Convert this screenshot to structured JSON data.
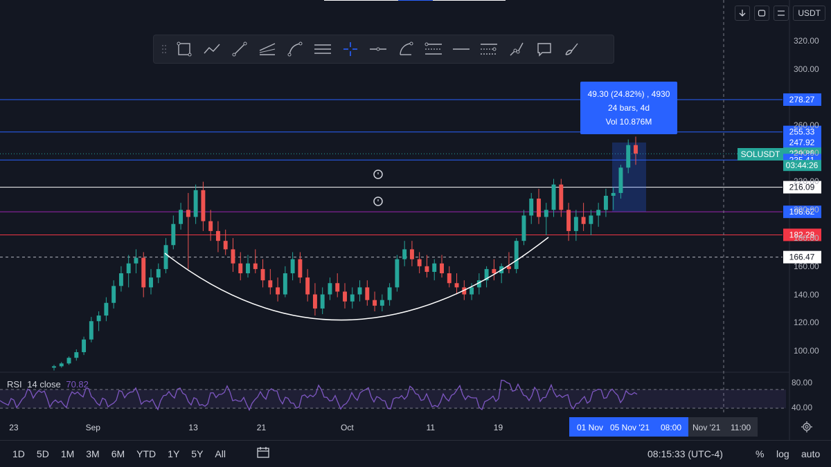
{
  "symbol": "SOLUSDT",
  "currency": "USDT",
  "toolbar": {
    "icons": [
      "grip-icon",
      "rectangle-icon",
      "path-icon",
      "trend-line-icon",
      "parallel-channel-icon",
      "curve-icon",
      "horizontal-lines-icon",
      "crosshair-icon",
      "horizontal-ray-icon",
      "arc-icon",
      "fib-retracement-icon",
      "horizontal-line-icon",
      "fib-extension-icon",
      "projection-icon",
      "callout-icon",
      "brush-icon"
    ]
  },
  "price_axis": {
    "ticks": [
      "320.00",
      "300.00",
      "260.00",
      "240.00",
      "220.00",
      "200.00",
      "180.00",
      "160.00",
      "140.00",
      "120.00",
      "100.00"
    ]
  },
  "price_labels": [
    {
      "value": 278.27,
      "text": "278.27",
      "bg": "#2962ff",
      "line": "#2962ff"
    },
    {
      "value": 255.33,
      "text": "255.33",
      "bg": "#2962ff",
      "line": "#2962ff"
    },
    {
      "value": 247.92,
      "text": "247.92",
      "bg": "#2962ff",
      "line": ""
    },
    {
      "value": 239.86,
      "text": "239.86",
      "bg": "#26a69a",
      "line": ""
    },
    {
      "value": 235.41,
      "text": "235.41",
      "bg": "#2962ff",
      "line": "#2962ff"
    },
    {
      "value": 216.09,
      "text": "216.09",
      "bg": "#ffffff",
      "line": "#ffffff"
    },
    {
      "value": 198.62,
      "text": "198.62",
      "bg": "#2962ff",
      "line": "#9c27b0"
    },
    {
      "value": 182.28,
      "text": "182.28",
      "bg": "#f23645",
      "line": "#f23645"
    },
    {
      "value": 166.47,
      "text": "166.47",
      "bg": "#ffffff",
      "line": "#b2b5be"
    }
  ],
  "countdown": "03:44:26",
  "measure_tooltip": {
    "line1": "49.30 (24.82%) , 4930",
    "line2": "24 bars, 4d",
    "line3": "Vol 10.876M"
  },
  "rsi": {
    "label": "RSI",
    "params": "14 close",
    "value": "70.82",
    "ticks": [
      "80.00",
      "40.00"
    ]
  },
  "time_axis": {
    "labels": [
      {
        "text": "23",
        "x": 0.016
      },
      {
        "text": "Sep",
        "x": 0.108
      },
      {
        "text": "13",
        "x": 0.232
      },
      {
        "text": "21",
        "x": 0.314
      },
      {
        "text": "Oct",
        "x": 0.415
      },
      {
        "text": "11",
        "x": 0.518
      },
      {
        "text": "19",
        "x": 0.599
      }
    ],
    "highlight": [
      "01 Nov",
      "05 Nov '21",
      "08:00"
    ],
    "extra": [
      "Nov '21",
      "11:00"
    ]
  },
  "bottom": {
    "ranges": [
      "1D",
      "5D",
      "1M",
      "3M",
      "6M",
      "YTD",
      "1Y",
      "5Y",
      "All"
    ],
    "clock": "08:15:33 (UTC-4)",
    "percent": "%",
    "log": "log",
    "auto": "auto"
  },
  "chart_data": {
    "type": "candlestick",
    "ylim": [
      85,
      335
    ],
    "x_start": "2021-08-20",
    "x_end": "2021-11-08",
    "candles": [
      [
        88,
        90,
        86,
        89
      ],
      [
        89,
        92,
        88,
        91
      ],
      [
        91,
        96,
        90,
        95
      ],
      [
        95,
        101,
        93,
        99
      ],
      [
        99,
        110,
        97,
        108
      ],
      [
        108,
        124,
        106,
        121
      ],
      [
        121,
        128,
        114,
        125
      ],
      [
        125,
        138,
        121,
        134
      ],
      [
        134,
        150,
        130,
        146
      ],
      [
        146,
        160,
        142,
        155
      ],
      [
        155,
        168,
        145,
        162
      ],
      [
        162,
        172,
        155,
        166
      ],
      [
        166,
        170,
        138,
        145
      ],
      [
        145,
        158,
        140,
        152
      ],
      [
        152,
        162,
        148,
        158
      ],
      [
        158,
        180,
        155,
        175
      ],
      [
        175,
        196,
        172,
        190
      ],
      [
        190,
        205,
        186,
        200
      ],
      [
        200,
        212,
        158,
        195
      ],
      [
        195,
        218,
        190,
        214
      ],
      [
        214,
        220,
        185,
        192
      ],
      [
        192,
        200,
        178,
        185
      ],
      [
        185,
        192,
        170,
        178
      ],
      [
        178,
        186,
        168,
        172
      ],
      [
        172,
        180,
        156,
        162
      ],
      [
        162,
        170,
        150,
        155
      ],
      [
        155,
        168,
        152,
        162
      ],
      [
        162,
        172,
        155,
        158
      ],
      [
        158,
        165,
        145,
        150
      ],
      [
        150,
        158,
        140,
        145
      ],
      [
        145,
        152,
        135,
        140
      ],
      [
        140,
        160,
        138,
        155
      ],
      [
        155,
        170,
        150,
        165
      ],
      [
        165,
        170,
        148,
        152
      ],
      [
        152,
        158,
        135,
        140
      ],
      [
        140,
        148,
        125,
        130
      ],
      [
        130,
        145,
        126,
        140
      ],
      [
        140,
        152,
        136,
        148
      ],
      [
        148,
        155,
        138,
        142
      ],
      [
        142,
        148,
        130,
        135
      ],
      [
        135,
        145,
        130,
        140
      ],
      [
        140,
        150,
        135,
        145
      ],
      [
        145,
        150,
        132,
        136
      ],
      [
        136,
        142,
        128,
        132
      ],
      [
        132,
        140,
        128,
        136
      ],
      [
        136,
        148,
        132,
        145
      ],
      [
        145,
        168,
        142,
        165
      ],
      [
        165,
        178,
        160,
        172
      ],
      [
        172,
        178,
        160,
        165
      ],
      [
        165,
        170,
        155,
        160
      ],
      [
        160,
        168,
        152,
        156
      ],
      [
        156,
        165,
        150,
        162
      ],
      [
        162,
        168,
        152,
        155
      ],
      [
        155,
        160,
        145,
        148
      ],
      [
        148,
        155,
        140,
        145
      ],
      [
        145,
        150,
        136,
        140
      ],
      [
        140,
        148,
        136,
        145
      ],
      [
        145,
        155,
        140,
        150
      ],
      [
        150,
        160,
        145,
        158
      ],
      [
        158,
        165,
        150,
        155
      ],
      [
        155,
        162,
        148,
        160
      ],
      [
        160,
        170,
        155,
        158
      ],
      [
        158,
        180,
        155,
        178
      ],
      [
        178,
        200,
        175,
        196
      ],
      [
        196,
        212,
        190,
        208
      ],
      [
        208,
        215,
        190,
        195
      ],
      [
        195,
        205,
        182,
        200
      ],
      [
        200,
        222,
        195,
        218
      ],
      [
        218,
        222,
        195,
        200
      ],
      [
        200,
        205,
        178,
        185
      ],
      [
        185,
        200,
        178,
        195
      ],
      [
        195,
        205,
        185,
        190
      ],
      [
        190,
        200,
        182,
        196
      ],
      [
        196,
        205,
        188,
        200
      ],
      [
        200,
        215,
        195,
        210
      ],
      [
        210,
        216,
        200,
        212
      ],
      [
        212,
        232,
        208,
        230
      ],
      [
        230,
        250,
        226,
        246
      ],
      [
        246,
        252,
        232,
        240
      ]
    ]
  }
}
